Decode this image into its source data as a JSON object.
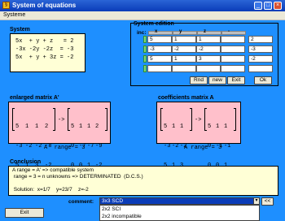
{
  "window": {
    "title": "System of equations",
    "app_icon": "system-app-icon",
    "minimize": "_",
    "maximize": "□",
    "close": "×"
  },
  "menu": {
    "items": [
      "Systeme"
    ]
  },
  "system": {
    "label": "System",
    "equations": [
      "5x  + y + z   = 2",
      "-3x -2y -2z  = -3",
      "5x  + y + 3z = -2"
    ]
  },
  "edition": {
    "label": "System edition",
    "inc_label": "inc:",
    "col_labels": [
      "x",
      "y",
      "z",
      "-"
    ],
    "matrix": [
      [
        "5",
        "1",
        "1"
      ],
      [
        "-3",
        "-2",
        "-2"
      ],
      [
        "5",
        "1",
        "3"
      ]
    ],
    "rhs": [
      "2",
      "-3",
      "-2"
    ],
    "buttons": {
      "rnd": "Rnd",
      "new": "new",
      "exit": "Exit",
      "ok": "Ok"
    }
  },
  "enlarged": {
    "label": "enlarged matrix A'",
    "left": [
      [
        "5",
        "1",
        "1",
        "2"
      ],
      [
        "-3",
        "-2",
        "-2",
        "-3"
      ],
      [
        "5",
        "1",
        "3",
        "-2"
      ]
    ],
    "arrow": "->",
    "right": [
      [
        "5",
        "1",
        "1",
        "2"
      ],
      [
        "0",
        "-7",
        "-7",
        "-9"
      ],
      [
        "0",
        "0",
        "1",
        "-2"
      ]
    ],
    "rank": "A' range = 3"
  },
  "coefficients": {
    "label": "coefficients matrix  A",
    "left": [
      [
        "5",
        "1",
        "1"
      ],
      [
        "-3",
        "-2",
        "-2"
      ],
      [
        "5",
        "1",
        "3"
      ]
    ],
    "arrow": "->",
    "right": [
      [
        "5",
        "1",
        "1"
      ],
      [
        "0",
        "-1",
        "-1"
      ],
      [
        "0",
        "0",
        "1"
      ]
    ],
    "rank": "A range = 3"
  },
  "conclusion": {
    "label": "Conclusion",
    "lines": [
      "A range = A' => compatible system",
      " range = 3 = n unknowns => DETERMINATED  (D.C.S.)",
      "",
      " Solution:  x=1/7    y=23/7    z=-2"
    ]
  },
  "comment": {
    "label": "comment:",
    "selected": "3x3 SCD",
    "options": [
      "2x2 SCI",
      "2x2 incompatible"
    ],
    "nav_button": "<<"
  },
  "exit_button": "Exit",
  "colors": {
    "client_bg": "#1e8fff",
    "yellow_box": "#ffffd6",
    "pink_box": "#ffc0cb"
  }
}
